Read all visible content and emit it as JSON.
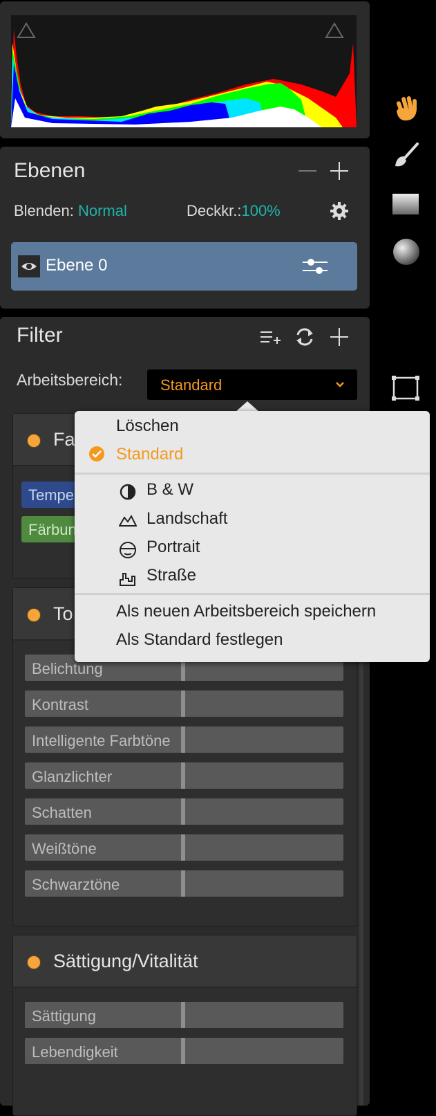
{
  "layers": {
    "title": "Ebenen",
    "blend_label": "Blenden:",
    "blend_value": "Normal",
    "opacity_label": "Deckkr.:",
    "opacity_value": "100%",
    "layer_name": "Ebene 0"
  },
  "filter": {
    "title": "Filter",
    "workspace_label": "Arbeitsbereich:",
    "workspace_value": "Standard",
    "groups": [
      {
        "title": "Fa",
        "chips": [
          "Tempe",
          "Färbun"
        ]
      },
      {
        "title": "To",
        "sliders": [
          "Belichtung",
          "Kontrast",
          "Intelligente Farbtöne",
          "Glanzlichter",
          "Schatten",
          "Weißtöne",
          "Schwarztöne"
        ]
      },
      {
        "title": "Sättigung/Vitalität",
        "sliders": [
          "Sättigung",
          "Lebendigkeit"
        ]
      }
    ]
  },
  "dropdown": {
    "items": {
      "delete": "Löschen",
      "standard": "Standard",
      "bw": "B & W",
      "landscape": "Landschaft",
      "portrait": "Portrait",
      "street": "Straße",
      "save_new": "Als neuen Arbeitsbereich speichern",
      "set_default": "Als Standard festlegen"
    }
  },
  "colors": {
    "accent_orange": "#f39a1e",
    "teal": "#1fb3ad",
    "layer_row": "#5c7a9c",
    "panel_bg": "#2b2b2b"
  }
}
